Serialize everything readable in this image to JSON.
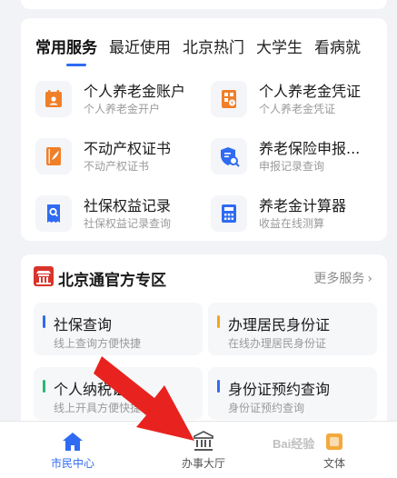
{
  "tabs": [
    {
      "label": "常用服务"
    },
    {
      "label": "最近使用"
    },
    {
      "label": "北京热门"
    },
    {
      "label": "大学生"
    },
    {
      "label": "看病就"
    }
  ],
  "services": [
    {
      "title": "个人养老金账户",
      "subtitle": "个人养老金开户",
      "icon": "calendar-person-icon"
    },
    {
      "title": "个人养老金凭证",
      "subtitle": "个人养老金凭证",
      "icon": "certificate-icon"
    },
    {
      "title": "不动产权证书",
      "subtitle": "不动产权证书",
      "icon": "property-book-icon"
    },
    {
      "title": "养老保险申报...",
      "subtitle": "申报记录查询",
      "icon": "shield-search-icon"
    },
    {
      "title": "社保权益记录",
      "subtitle": "社保权益记录查询",
      "icon": "receipt-search-icon"
    },
    {
      "title": "养老金计算器",
      "subtitle": "收益在线测算",
      "icon": "calculator-icon"
    }
  ],
  "official": {
    "title": "北京通官方专区",
    "more": "更多服务",
    "tiles": [
      {
        "title": "社保查询",
        "subtitle": "线上查询方便快捷",
        "accent": "#2f6bf2"
      },
      {
        "title": "办理居民身份证",
        "subtitle": "在线办理居民身份证",
        "accent": "#f2a81d"
      },
      {
        "title": "个人纳税证",
        "subtitle": "线上开具方便快捷",
        "accent": "#2bb673"
      },
      {
        "title": "身份证预约查询",
        "subtitle": "身份证预约查询",
        "accent": "#2f6bf2"
      }
    ]
  },
  "bottom_nav": [
    {
      "label": "市民中心",
      "active": true,
      "icon": "home-icon"
    },
    {
      "label": "办事大厅",
      "active": false,
      "icon": "government-building-icon"
    },
    {
      "label": "文体",
      "active": false,
      "icon": "culture-icon"
    }
  ],
  "colors": {
    "primary": "#2f6bf2",
    "orange": "#f07f2a",
    "annotation_arrow": "#e8231f"
  },
  "watermark": "Bai经验"
}
